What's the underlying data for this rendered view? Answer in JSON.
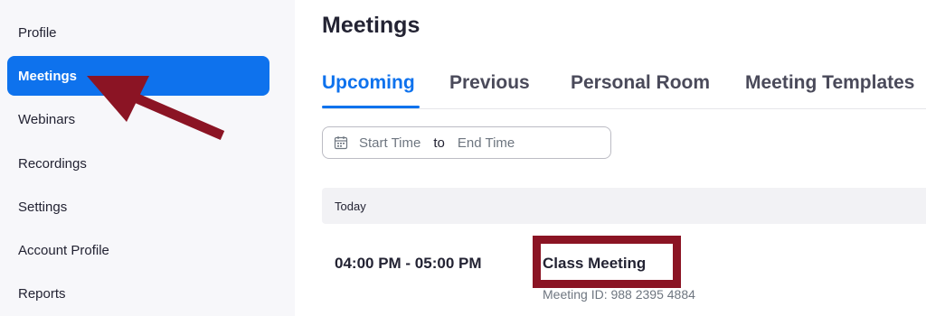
{
  "sidebar": {
    "items": [
      {
        "label": "Profile",
        "active": false
      },
      {
        "label": "Meetings",
        "active": true
      },
      {
        "label": "Webinars",
        "active": false
      },
      {
        "label": "Recordings",
        "active": false
      },
      {
        "label": "Settings",
        "active": false
      },
      {
        "label": "Account Profile",
        "active": false
      },
      {
        "label": "Reports",
        "active": false
      }
    ]
  },
  "main": {
    "title": "Meetings",
    "tabs": [
      {
        "label": "Upcoming",
        "active": true
      },
      {
        "label": "Previous",
        "active": false
      },
      {
        "label": "Personal Room",
        "active": false
      },
      {
        "label": "Meeting Templates",
        "active": false
      }
    ],
    "date_range": {
      "start_placeholder": "Start Time",
      "separator": "to",
      "end_placeholder": "End Time",
      "icon": "calendar-icon"
    },
    "day_header": "Today",
    "meeting": {
      "time": "04:00 PM - 05:00 PM",
      "topic": "Class Meeting",
      "meeting_id": "Meeting ID: 988 2395 4884"
    }
  },
  "colors": {
    "accent": "#0e72ed",
    "annotation": "#8b1424"
  },
  "annotations": [
    "arrow pointing to Meetings sidebar item",
    "box highlighting Class Meeting topic"
  ]
}
